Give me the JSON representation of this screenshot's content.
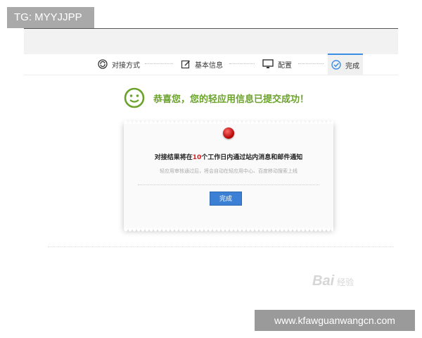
{
  "tag_badge": "TG: MYYJJPP",
  "steps": [
    {
      "label": "对接方式",
      "icon": "refresh-cycle-icon"
    },
    {
      "label": "基本信息",
      "icon": "edit-icon"
    },
    {
      "label": "配置",
      "icon": "monitor-icon"
    },
    {
      "label": "完成",
      "icon": "check-circle-icon",
      "active": true
    }
  ],
  "success": {
    "icon": "smiley-face-icon",
    "message": "恭喜您，您的轻应用信息已提交成功！",
    "color": "#6aa22a"
  },
  "card": {
    "pin_icon": "red-pin-icon",
    "title_pre": "对接结果将在",
    "title_num": "10",
    "title_post": "个工作日内通过站内消息和邮件通知",
    "subtitle": "轻应用审核通过后，将会自动在轻应用中心、百度移动搜索上线",
    "button_label": "完成"
  },
  "watermark": {
    "brand": "Bai",
    "suffix": "经验"
  },
  "url_badge": "www.kfawguanwangcn.com",
  "colors": {
    "accent": "#3b80d4",
    "success": "#6aa22a",
    "highlight": "#d62020"
  }
}
